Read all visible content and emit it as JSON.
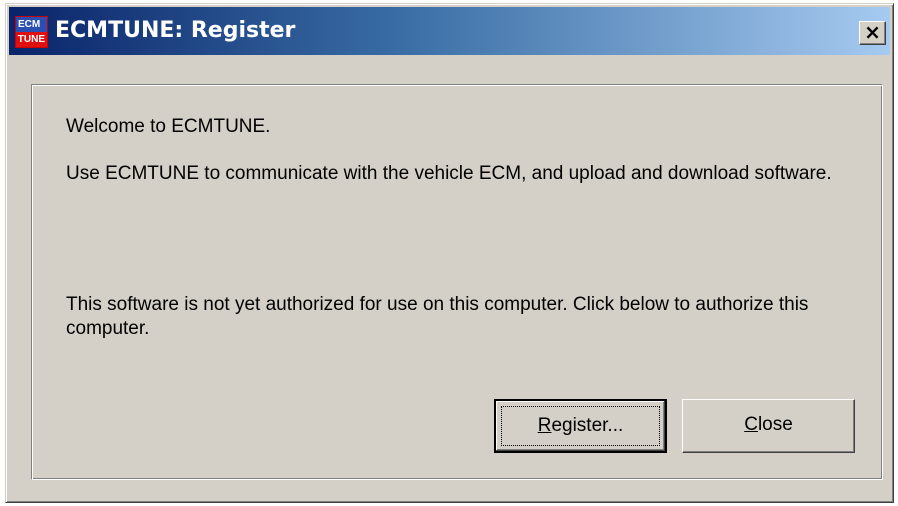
{
  "window": {
    "title": "ECMTUNE: Register",
    "icon_top_text": "ECM",
    "icon_bottom_text": "TUNE",
    "close_glyph": "×"
  },
  "message": {
    "welcome": "Welcome to ECMTUNE.",
    "description": "Use ECMTUNE to communicate with the vehicle ECM, and upload and download software.",
    "authorization": "This software is not yet authorized for use on this computer.  Click below to authorize this computer."
  },
  "buttons": {
    "register": {
      "mnemonic": "R",
      "rest": "egister...",
      "is_default": true
    },
    "close": {
      "mnemonic": "C",
      "rest": "lose"
    }
  },
  "colors": {
    "face": "#d4d0c8",
    "title_start": "#0a246a",
    "title_end": "#a6caf0"
  },
  "icons": {
    "app": "ecmtune-app-icon",
    "close": "close-icon"
  }
}
